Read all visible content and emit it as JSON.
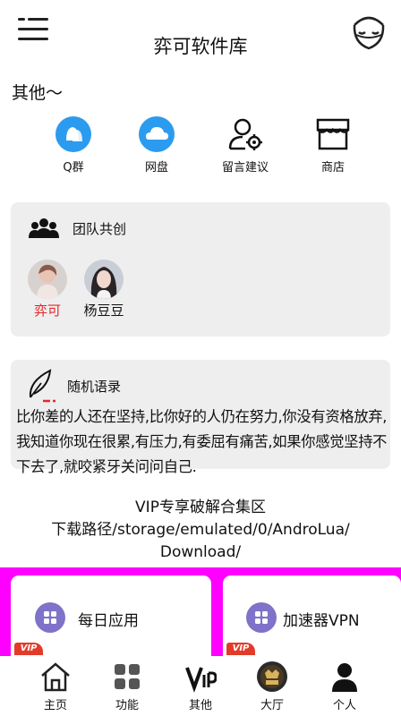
{
  "header": {
    "title": "弈可软件库"
  },
  "section": {
    "label": "其他～"
  },
  "quick_links": [
    {
      "label": "Q群",
      "icon": "qq-group-icon"
    },
    {
      "label": "网盘",
      "icon": "cloud-icon"
    },
    {
      "label": "留言建议",
      "icon": "user-settings-icon"
    },
    {
      "label": "商店",
      "icon": "store-icon"
    }
  ],
  "team": {
    "heading": "团队共创",
    "members": [
      {
        "name": "弈可",
        "name_color": "#e8262a"
      },
      {
        "name": "杨豆豆",
        "name_color": "#111111"
      }
    ]
  },
  "quote": {
    "heading": "随机语录",
    "text": "比你差的人还在坚持,比你好的人仍在努力,你没有资格放弃,我知道你现在很累,有压力,有委屈有痛苦,如果你感觉坚持不下去了,就咬紧牙关问问自己."
  },
  "vip": {
    "line1": "VIP专享破解合集区",
    "line2": "下载路径/storage/emulated/0/AndroLua/",
    "line3": "Download/"
  },
  "panels": [
    {
      "label": "每日应用",
      "tag": "VIP"
    },
    {
      "label": "加速器VPN",
      "tag": "VIP"
    }
  ],
  "bottom_nav": [
    {
      "label": "主页",
      "icon": "home-icon"
    },
    {
      "label": "功能",
      "icon": "grid-icon"
    },
    {
      "label": "其他",
      "icon": "vip-icon"
    },
    {
      "label": "大厅",
      "icon": "vip-badge-icon"
    },
    {
      "label": "个人",
      "icon": "person-icon"
    }
  ],
  "colors": {
    "accent_blue": "#2b9bef",
    "magenta": "#ff00ff",
    "panel_icon": "#7f72c9",
    "vip_tag": "#e23b2a"
  }
}
